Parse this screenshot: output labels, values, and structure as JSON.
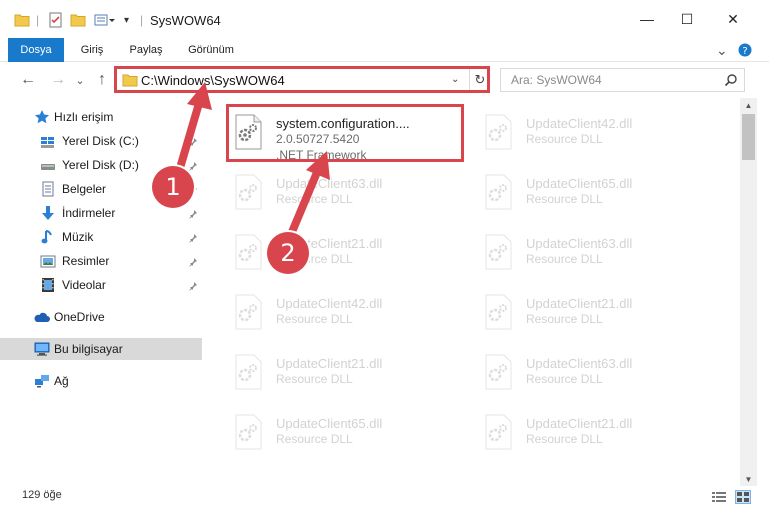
{
  "window": {
    "title": "SysWOW64",
    "minimize_glyph": "—",
    "maximize_glyph": "☐",
    "close_glyph": "✕"
  },
  "ribbon": {
    "tabs": [
      {
        "label": "Dosya",
        "active": true
      },
      {
        "label": "Giriş",
        "active": false
      },
      {
        "label": "Paylaş",
        "active": false
      },
      {
        "label": "Görünüm",
        "active": false
      }
    ],
    "expand_glyph": "⌄",
    "help_glyph": "?"
  },
  "address_bar": {
    "path": "C:\\Windows\\SysWOW64",
    "dropdown_glyph": "⌄",
    "refresh_glyph": "↻",
    "back_glyph": "←",
    "forward_glyph": "→",
    "recent_glyph": "⌄",
    "up_glyph": "↑"
  },
  "search": {
    "placeholder": "Ara: SysWOW64"
  },
  "sidebar": {
    "items": [
      {
        "label": "Hızlı erişim",
        "icon": "star-icon"
      },
      {
        "label": "Yerel Disk (C:)",
        "icon": "drive-icon",
        "pinned": true
      },
      {
        "label": "Yerel Disk (D:)",
        "icon": "drive-icon",
        "pinned": true
      },
      {
        "label": "Belgeler",
        "icon": "documents-icon",
        "pinned": true
      },
      {
        "label": "İndirmeler",
        "icon": "download-icon",
        "pinned": true
      },
      {
        "label": "Müzik",
        "icon": "music-icon",
        "pinned": true
      },
      {
        "label": "Resimler",
        "icon": "pictures-icon",
        "pinned": true
      },
      {
        "label": "Videolar",
        "icon": "videos-icon",
        "pinned": true
      },
      {
        "label": "OneDrive",
        "icon": "onedrive-icon"
      },
      {
        "label": "Bu bilgisayar",
        "icon": "computer-icon",
        "selected": true
      },
      {
        "label": "Ağ",
        "icon": "network-icon"
      }
    ]
  },
  "files": [
    {
      "name": "system.configuration....",
      "line1": "2.0.50727.5420",
      "line2": ".NET Framework",
      "faded": false
    },
    {
      "name": "UpdateClient42.dll",
      "line1": "Resource DLL",
      "faded": true
    },
    {
      "name": "UpdateClient63.dll",
      "line1": "Resource DLL",
      "faded": true
    },
    {
      "name": "UpdateClient65.dll",
      "line1": "Resource DLL",
      "faded": true
    },
    {
      "name": "UpdateClient21.dll",
      "line1": "Resource DLL",
      "faded": true
    },
    {
      "name": "UpdateClient63.dll",
      "line1": "Resource DLL",
      "faded": true
    },
    {
      "name": "UpdateClient42.dll",
      "line1": "Resource DLL",
      "faded": true
    },
    {
      "name": "UpdateClient21.dll",
      "line1": "Resource DLL",
      "faded": true
    },
    {
      "name": "UpdateClient21.dll",
      "line1": "Resource DLL",
      "faded": true
    },
    {
      "name": "UpdateClient63.dll",
      "line1": "Resource DLL",
      "faded": true
    },
    {
      "name": "UpdateClient65.dll",
      "line1": "Resource DLL",
      "faded": true
    },
    {
      "name": "UpdateClient21.dll",
      "line1": "Resource DLL",
      "faded": true
    }
  ],
  "status": {
    "item_count": "129 öğe"
  },
  "annotations": {
    "badge1": "1",
    "badge2": "2",
    "color": "#d9454c"
  },
  "colors": {
    "ribbon_active": "#1979ca",
    "folder": "#f2c94c"
  }
}
